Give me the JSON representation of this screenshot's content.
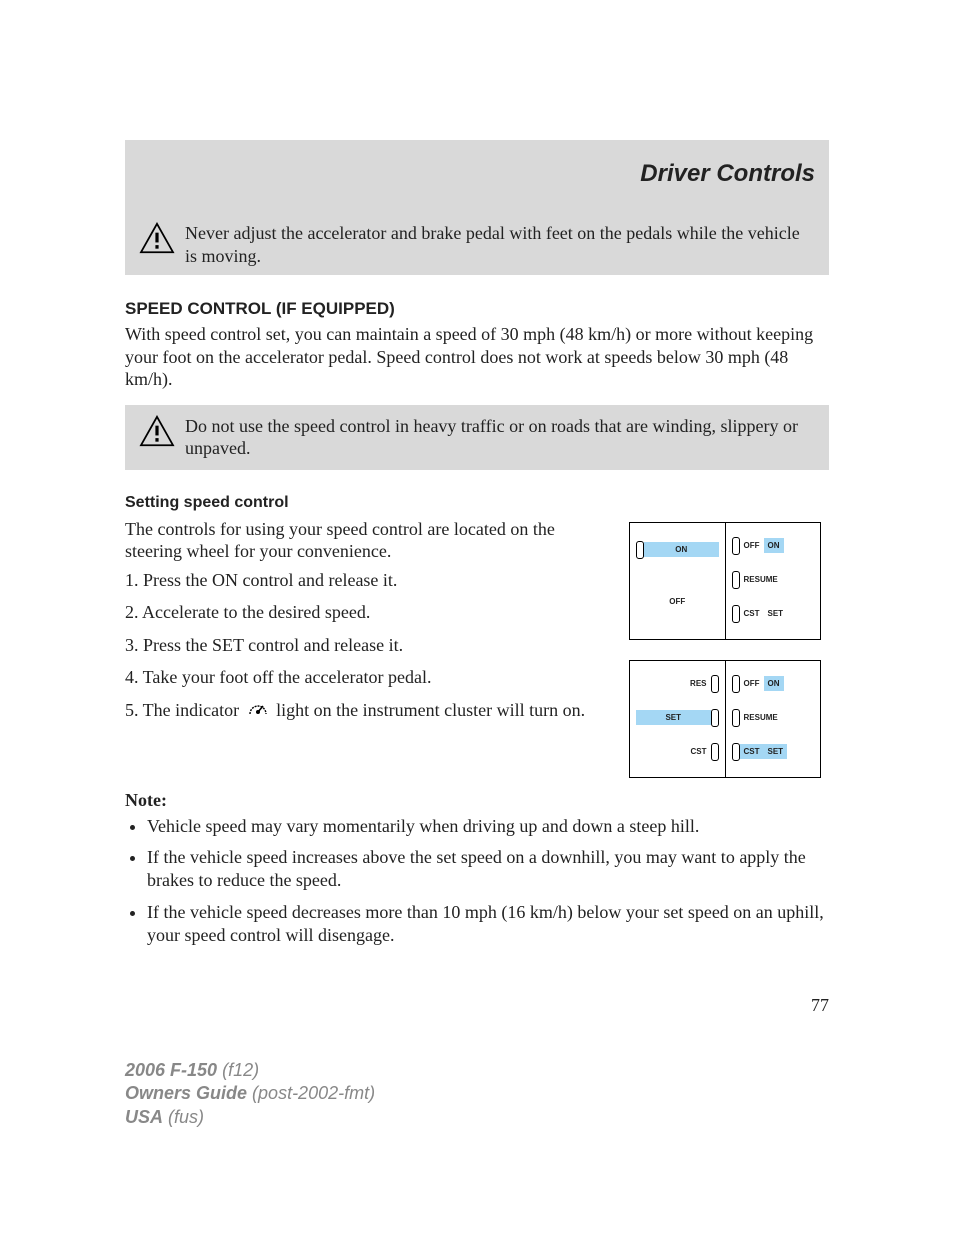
{
  "header": {
    "section_title": "Driver Controls"
  },
  "warning1": {
    "text": "Never adjust the accelerator and brake pedal with feet on the pedals while the vehicle is moving."
  },
  "speed_control": {
    "heading": "SPEED CONTROL (IF EQUIPPED)",
    "intro": "With speed control set, you can maintain a speed of 30 mph (48 km/h) or more without keeping your foot on the accelerator pedal. Speed control does not work at speeds below 30 mph (48 km/h)."
  },
  "warning2": {
    "text": "Do not use the speed control in heavy traffic or on roads that are winding, slippery or unpaved."
  },
  "setting": {
    "heading": "Setting speed control",
    "intro": "The controls for using your speed control are located on the steering wheel for your convenience.",
    "step1": "1. Press the ON control and release it.",
    "step2": "2. Accelerate to the desired speed.",
    "step3": "3. Press the SET control and release it.",
    "step4": "4. Take your foot off the accelerator pedal.",
    "step5a": "5. The indicator",
    "step5b": "light on the instrument cluster will turn on."
  },
  "diagrams": {
    "d1_left_top": "ON",
    "d1_left_bot": "OFF",
    "d1_right_top_a": "OFF",
    "d1_right_top_b": "ON",
    "d1_right_mid": "RESUME",
    "d1_right_bot_a": "CST",
    "d1_right_bot_b": "SET",
    "d2_left_top": "RES",
    "d2_left_mid": "SET",
    "d2_left_bot": "CST",
    "d2_right_top_a": "OFF",
    "d2_right_top_b": "ON",
    "d2_right_mid": "RESUME",
    "d2_right_bot_a": "CST",
    "d2_right_bot_b": "SET"
  },
  "notes": {
    "label": "Note:",
    "items": [
      "Vehicle speed may vary momentarily when driving up and down a steep hill.",
      "If the vehicle speed increases above the set speed on a downhill, you may want to apply the brakes to reduce the speed.",
      "If the vehicle speed decreases more than 10 mph (16 km/h) below your set speed on an uphill, your speed control will disengage."
    ]
  },
  "page_number": "77",
  "footer": {
    "line1_bold": "2006 F-150",
    "line1_rest": "(f12)",
    "line2_bold": "Owners Guide",
    "line2_rest": "(post-2002-fmt)",
    "line3_bold": "USA",
    "line3_rest": "(fus)"
  }
}
